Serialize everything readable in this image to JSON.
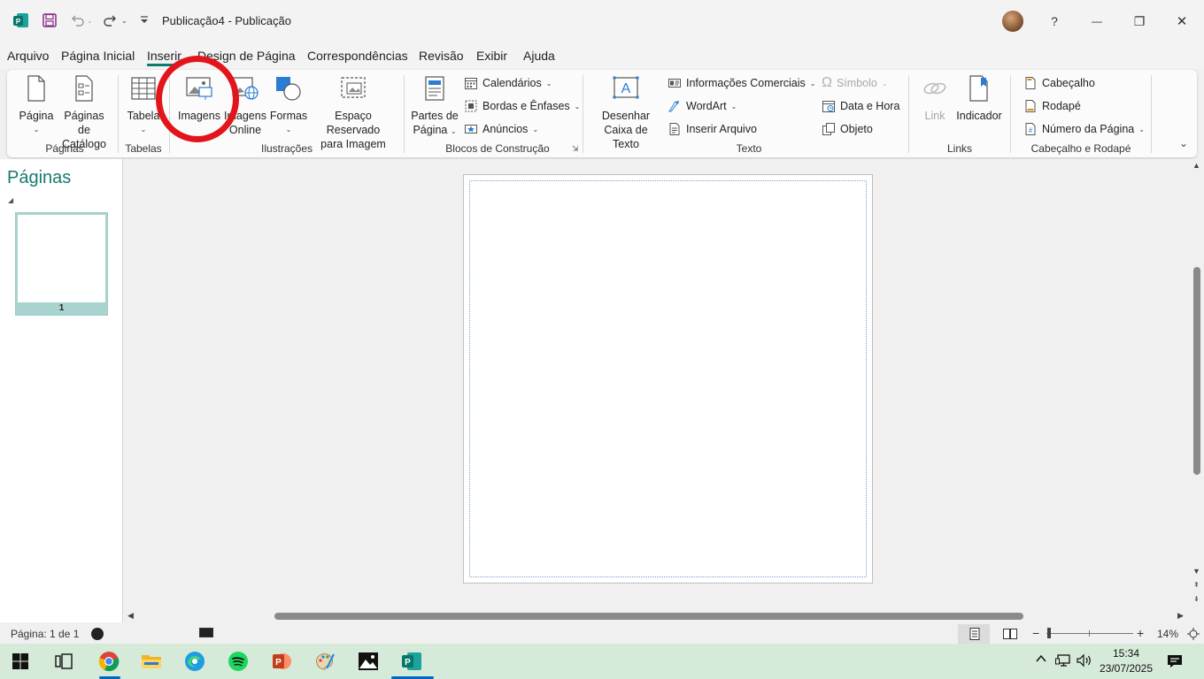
{
  "window": {
    "title": "Publicação4  -  Publicação",
    "help": "?",
    "minimize": "—",
    "restore": "❐",
    "close": "✕"
  },
  "menu": {
    "items": [
      "Arquivo",
      "Página Inicial",
      "Inserir",
      "Design de Página",
      "Correspondências",
      "Revisão",
      "Exibir",
      "Ajuda"
    ],
    "active": "Inserir"
  },
  "ribbon": {
    "paginas": {
      "pagina": "Página",
      "paginas_catalogo_1": "Páginas de",
      "paginas_catalogo_2": "Catálogo",
      "label": "Páginas"
    },
    "tabelas": {
      "tabela": "Tabela",
      "label": "Tabelas"
    },
    "ilustracoes": {
      "imagens": "Imagens",
      "imagens_online_1": "Imagens",
      "imagens_online_2": "Online",
      "formas": "Formas",
      "espaco_1": "Espaço Reservado",
      "espaco_2": "para Imagem",
      "label": "Ilustrações"
    },
    "blocos": {
      "partes_1": "Partes de",
      "partes_2": "Página",
      "calendarios": "Calendários",
      "bordas": "Bordas e Ênfases",
      "anuncios": "Anúncios",
      "label": "Blocos de Construção"
    },
    "texto": {
      "desenhar_1": "Desenhar",
      "desenhar_2": "Caixa de Texto",
      "informacoes": "Informações Comerciais",
      "wordart": "WordArt",
      "inserir_arquivo": "Inserir Arquivo",
      "simbolo": "Símbolo",
      "data_hora": "Data e Hora",
      "objeto": "Objeto",
      "label": "Texto"
    },
    "links": {
      "link": "Link",
      "indicador": "Indicador",
      "label": "Links"
    },
    "cabecalho": {
      "cabecalho": "Cabeçalho",
      "rodape": "Rodapé",
      "numero": "Número da Página",
      "label": "Cabeçalho e Rodapé"
    }
  },
  "pages_pane": {
    "title": "Páginas",
    "thumb_number": "1"
  },
  "status": {
    "page_info": "Página: 1 de 1",
    "zoom": "14%"
  },
  "taskbar": {
    "time": "15:34",
    "date": "23/07/2025"
  },
  "colors": {
    "accent": "#0e7a6e",
    "highlight_circle": "#e3141b",
    "taskbar": "#d6ead9"
  }
}
